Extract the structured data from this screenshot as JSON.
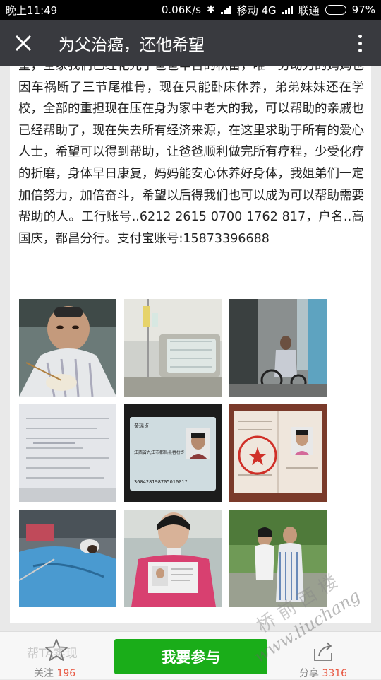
{
  "status_bar": {
    "time": "晚上11:49",
    "speed": "0.06K/s",
    "carrier1": "移动 4G",
    "carrier2": "联通",
    "battery": "97%",
    "battery_level": 0.97
  },
  "header": {
    "title": "为父治癌，还他希望"
  },
  "article": {
    "text": "望，全家我们已经花光了爸爸辛苦的积蓄，唯一劳动力的妈妈也因车祸断了三节尾椎骨，现在只能卧床休养，弟弟妹妹还在学校，全部的重担现在压在身为家中老大的我，可以帮助的亲戚也已经帮助了，现在失去所有经济来源，在这里求助于所有的爱心人士，希望可以得到帮助，让爸爸顺利做完所有疗程，少受化疗的折磨，身体早日康复，妈妈能安心休养好身体，我姐弟们一定加倍努力，加倍奋斗，希望以后得我们也可以成为可以帮助需要帮助的人。工行账号..6212 2615 0700 1762 817，户名..高国庆，都昌分行。支付宝账号:15873396688"
  },
  "photos": {
    "id_card": {
      "name": "黄瑶贞",
      "address": "江西省九江市都昌县春桥乡",
      "number": "36042819870501001?"
    }
  },
  "bottom_bar": {
    "follow_label": "关注",
    "follow_count": "196",
    "join_label": "我要参与",
    "share_label": "分享",
    "share_count": "3316",
    "ghost_text": "帮TA实现"
  },
  "watermark": {
    "text": "www.liuchang",
    "text2": "桥 前 西 楼"
  }
}
